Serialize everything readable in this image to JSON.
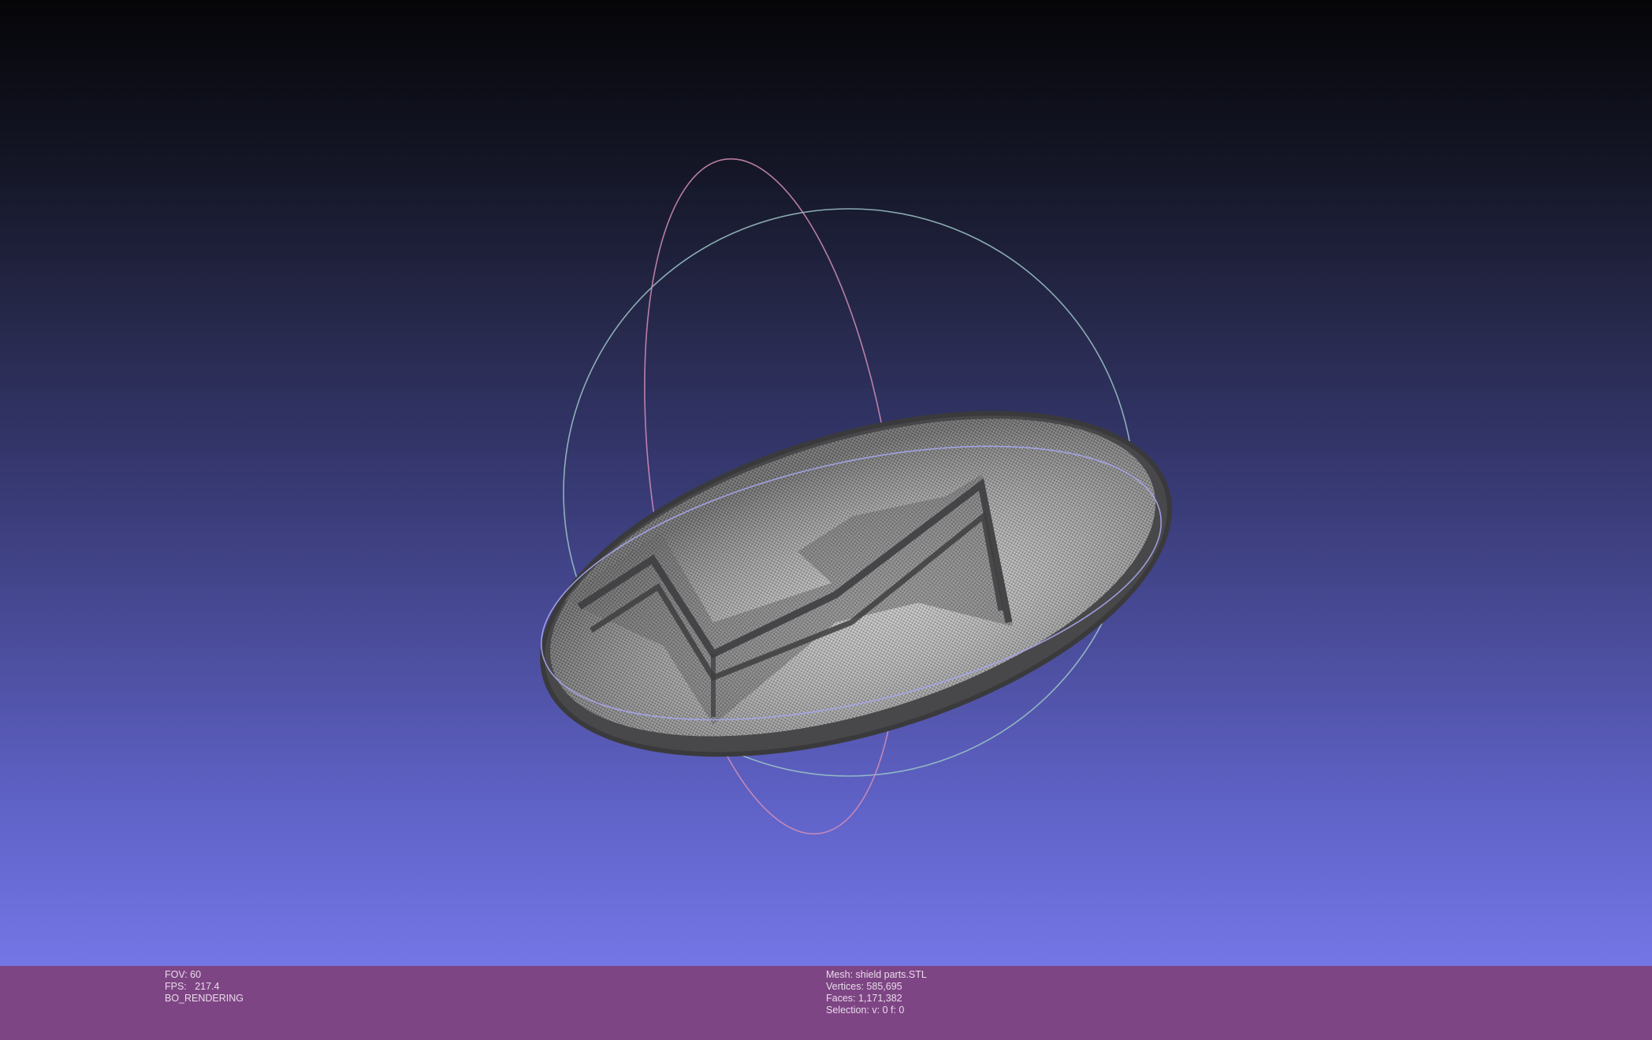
{
  "status_left": {
    "fov": "FOV: 60",
    "fps": "FPS:   217.4",
    "render_mode": "BO_RENDERING"
  },
  "status_right": {
    "mesh": "Mesh: shield parts.STL",
    "vertices": "Vertices: 585,695",
    "faces": "Faces: 1,171,382",
    "selection": "Selection: v: 0 f: 0"
  },
  "colors": {
    "info_bar": "#7e4584",
    "mesh_dark": "#4a4a4c",
    "mesh_light": "#d8d8d8",
    "trackball_x": "#d28fb6",
    "trackball_y": "#9ec6c8",
    "trackball_z": "#a6a6ee"
  },
  "icons": {
    "trackball": "trackball-gizmo",
    "mesh": "shield-mesh"
  }
}
